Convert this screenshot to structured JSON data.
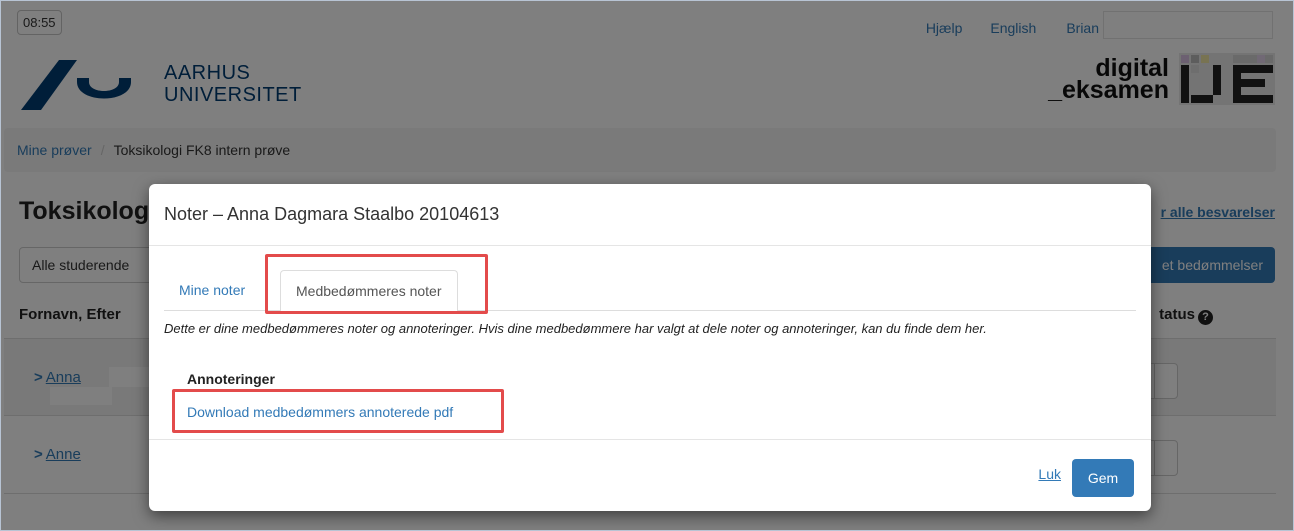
{
  "topbar": {
    "clock": "08:55",
    "help": "Hjælp",
    "language": "English",
    "user": "Brian"
  },
  "logo": {
    "line1": "AARHUS",
    "line2": "UNIVERSITET",
    "de_line1": "digital",
    "de_line2": "_eksamen"
  },
  "breadcrumb": {
    "home": "Mine prøver",
    "current": "Toksikologi FK8 intern prøve"
  },
  "background": {
    "page_title": "Toksikolog",
    "filter_label": "Alle studerende",
    "column_header": "Fornavn, Efter",
    "students": [
      "Anna",
      "Anne"
    ],
    "all_submissions_link": "r alle besvarelser",
    "grades_button": "et bedømmelser",
    "status_header": "tatus"
  },
  "modal": {
    "title": "Noter  –  Anna Dagmara Staalbo 20104613",
    "tabs": [
      {
        "label": "Mine noter",
        "active": false
      },
      {
        "label": "Medbedømmeres noter",
        "active": true
      }
    ],
    "description": "Dette er dine medbedømmeres noter og annoteringer. Hvis dine medbedømmere har valgt at dele noter og annoteringer, kan du finde dem her.",
    "annotations_heading": "Annoteringer",
    "download_link": "Download medbedømmers annoterede pdf",
    "close_label": "Luk",
    "save_label": "Gem"
  },
  "colors": {
    "link": "#337ab7",
    "primary_button": "#337ab7",
    "highlight": "#e34b4b",
    "au_blue": "#003d73"
  }
}
